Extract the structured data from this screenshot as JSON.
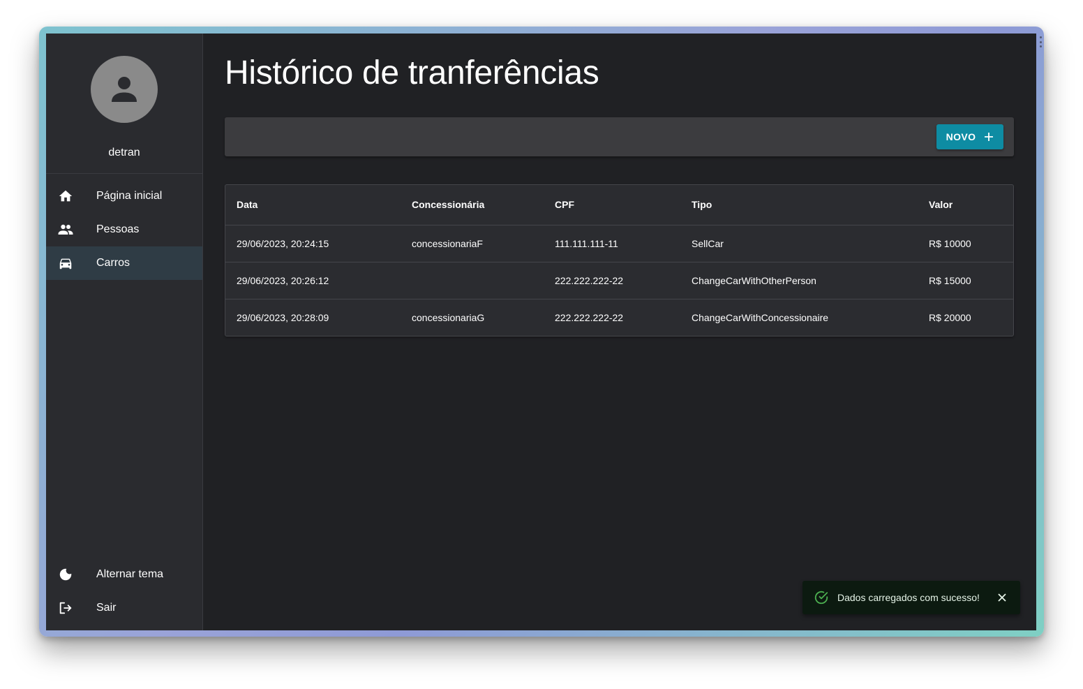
{
  "sidebar": {
    "username": "detran",
    "items": [
      {
        "label": "Página inicial",
        "icon": "home-icon",
        "active": false
      },
      {
        "label": "Pessoas",
        "icon": "people-icon",
        "active": false
      },
      {
        "label": "Carros",
        "icon": "car-icon",
        "active": true
      }
    ],
    "bottom_items": [
      {
        "label": "Alternar tema",
        "icon": "moon-icon"
      },
      {
        "label": "Sair",
        "icon": "logout-icon"
      }
    ]
  },
  "main": {
    "title": "Histórico de tranferências",
    "toolbar": {
      "new_button_label": "NOVO",
      "new_button_icon": "plus-icon"
    }
  },
  "table": {
    "columns": [
      "Data",
      "Concessionária",
      "CPF",
      "Tipo",
      "Valor"
    ],
    "rows": [
      [
        "29/06/2023, 20:24:15",
        "concessionariaF",
        "111.111.111-11",
        "SellCar",
        "R$ 10000"
      ],
      [
        "29/06/2023, 20:26:12",
        "",
        "222.222.222-22",
        "ChangeCarWithOtherPerson",
        "R$ 15000"
      ],
      [
        "29/06/2023, 20:28:09",
        "concessionariaG",
        "222.222.222-22",
        "ChangeCarWithConcessionaire",
        "R$ 20000"
      ]
    ]
  },
  "snackbar": {
    "message": "Dados carregados com sucesso!",
    "icon": "check-circle-icon",
    "close_icon": "close-icon"
  },
  "colors": {
    "background": "#202124",
    "sidebar": "#2a2b2f",
    "active_nav": "#2f3c45",
    "accent": "#0e8ca3",
    "success": "#4caf50",
    "snackbar_bg": "#0c1a10"
  }
}
